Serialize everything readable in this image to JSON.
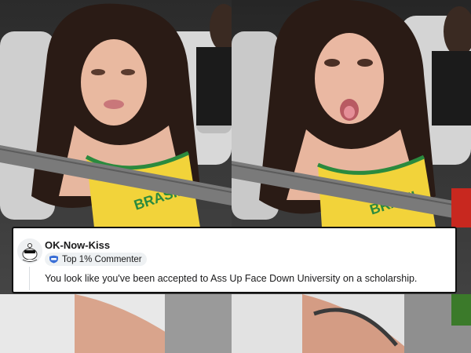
{
  "comment": {
    "username": "OK-Now-Kiss",
    "badge_label": "Top 1% Commenter",
    "badge_icon": "shield-icon",
    "body": "You look like you've been accepted to Ass Up Face Down University on a scholarship.",
    "avatar_icon": "snoo-avatar-icon"
  },
  "photos": [
    {
      "name": "left-photo",
      "shirt_text": "BRASIL",
      "colors": {
        "shirt": "#f2d33a",
        "shirt_trim": "#2b8a3e",
        "hair": "#2a1b15",
        "skin": "#e9b9a0",
        "seat": "#cfcfcf"
      }
    },
    {
      "name": "right-photo",
      "shirt_text": "BRASIL",
      "colors": {
        "shirt": "#f2d33a",
        "shirt_trim": "#2b8a3e",
        "hair": "#2a1b15",
        "skin": "#eab8a2",
        "seat": "#c9c9c9"
      }
    }
  ],
  "colors": {
    "card_border": "#111111",
    "card_background": "#ffffff",
    "badge_background": "#eef1f3",
    "text": "#1a1a1b"
  }
}
